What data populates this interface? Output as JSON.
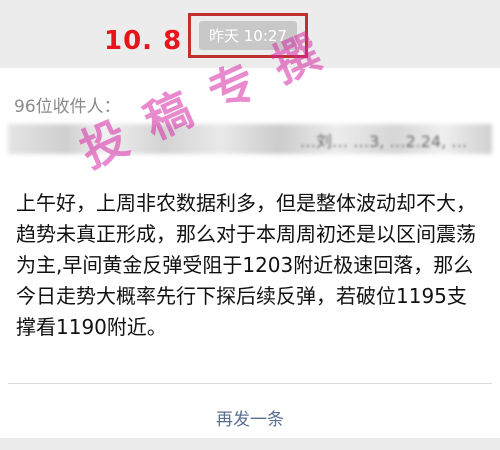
{
  "annotation": {
    "date": "10. 8",
    "color": "#e8141b"
  },
  "header": {
    "timestamp": "昨天 10:27"
  },
  "recipients": {
    "label": "96位收件人：",
    "names_blurred": "…刘… …3, …2.24, …"
  },
  "watermark": "投稿专撰",
  "message": {
    "body": "上午好，上周非农数据利多，但是整体波动却不大，趋势未真正形成，那么对于本周周初还是以区间震荡为主,早间黄金反弹受阻于1203附近极速回落，那么今日走势大概率先行下探后续反弹，若破位1195支撑看1190附近。"
  },
  "actions": {
    "resend_label": "再发一条"
  }
}
